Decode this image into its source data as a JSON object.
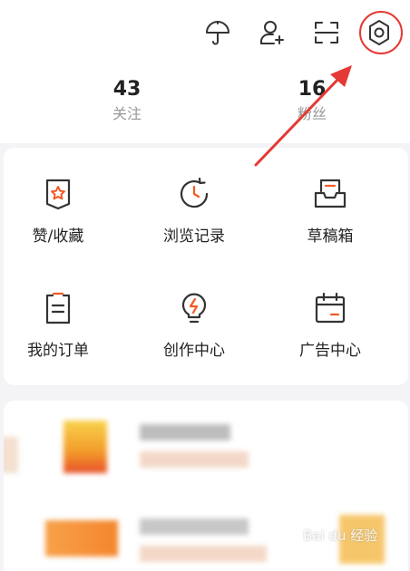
{
  "toolbar": {
    "icons": [
      "umbrella-icon",
      "add-user-icon",
      "scan-icon",
      "settings-icon"
    ]
  },
  "stats": {
    "following": {
      "count": "43",
      "label": "关注"
    },
    "fans": {
      "count": "16",
      "label": "粉丝"
    }
  },
  "menu": {
    "items": [
      {
        "label": "赞/收藏",
        "icon": "favorites-badge-icon"
      },
      {
        "label": "浏览记录",
        "icon": "history-clock-icon"
      },
      {
        "label": "草稿箱",
        "icon": "drafts-tray-icon"
      },
      {
        "label": "我的订单",
        "icon": "orders-clipboard-icon"
      },
      {
        "label": "创作中心",
        "icon": "creator-bulb-icon"
      },
      {
        "label": "广告中心",
        "icon": "ad-calendar-icon"
      }
    ]
  },
  "colors": {
    "accent": "#f25a24",
    "annotation": "#e53935",
    "text": "#222222",
    "muted": "#999999"
  },
  "watermark": "Bai du 经验"
}
